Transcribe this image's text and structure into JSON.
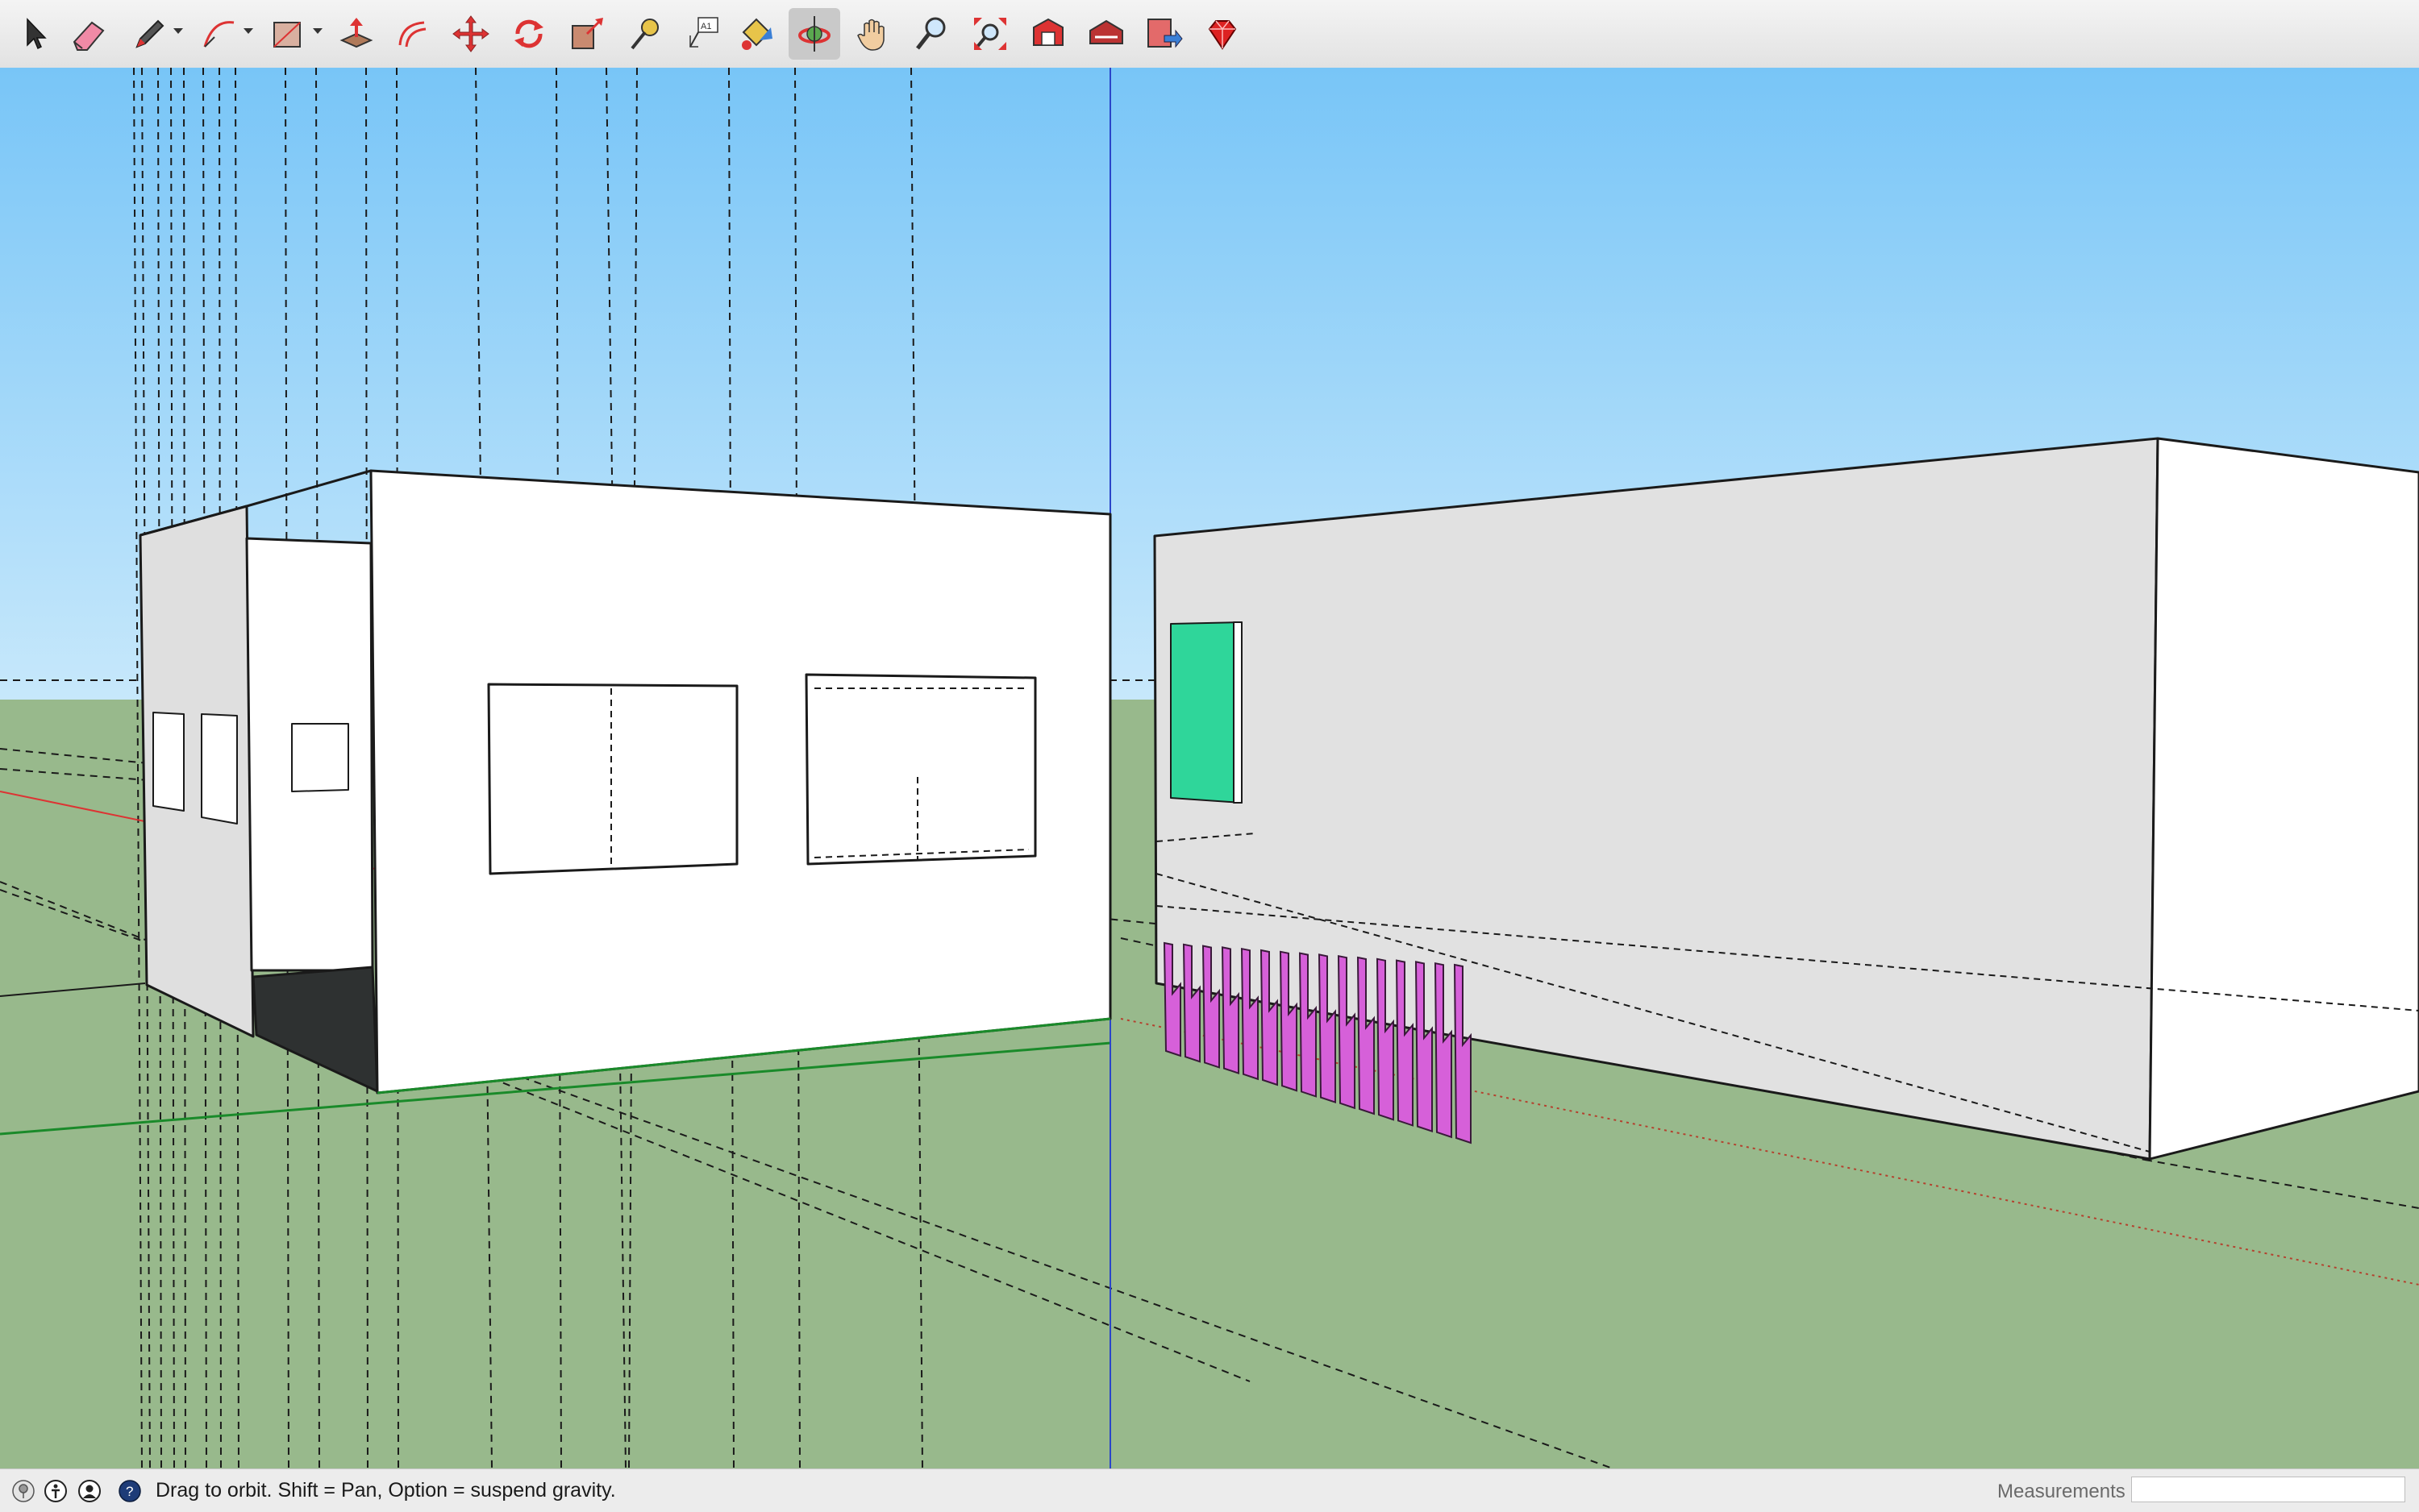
{
  "toolbar": {
    "tools": [
      {
        "name": "select-tool",
        "icon": "arrow-cursor-icon"
      },
      {
        "name": "eraser-tool",
        "icon": "eraser-icon"
      },
      {
        "name": "line-tool",
        "icon": "pencil-icon",
        "has_dropdown": true
      },
      {
        "name": "arc-tool",
        "icon": "arc-icon",
        "has_dropdown": true
      },
      {
        "name": "shapes-tool",
        "icon": "rectangle-icon",
        "has_dropdown": true
      },
      {
        "name": "push-pull-tool",
        "icon": "push-pull-icon"
      },
      {
        "name": "offset-tool",
        "icon": "offset-icon"
      },
      {
        "name": "move-tool",
        "icon": "move-arrows-icon"
      },
      {
        "name": "rotate-tool",
        "icon": "rotate-icon"
      },
      {
        "name": "scale-tool",
        "icon": "scale-icon"
      },
      {
        "name": "tape-measure-tool",
        "icon": "tape-measure-icon"
      },
      {
        "name": "text-tool",
        "icon": "text-label-icon",
        "label": "A1"
      },
      {
        "name": "paint-bucket-tool",
        "icon": "paint-bucket-icon"
      },
      {
        "name": "orbit-tool",
        "icon": "orbit-icon",
        "active": true
      },
      {
        "name": "pan-tool",
        "icon": "hand-icon"
      },
      {
        "name": "zoom-tool",
        "icon": "magnifier-icon"
      },
      {
        "name": "zoom-extents-tool",
        "icon": "zoom-extents-icon"
      },
      {
        "name": "3d-warehouse-tool",
        "icon": "warehouse-icon"
      },
      {
        "name": "extension-warehouse-tool",
        "icon": "extension-warehouse-icon"
      },
      {
        "name": "send-to-layout-tool",
        "icon": "layout-send-icon"
      },
      {
        "name": "extension-manager-tool",
        "icon": "ruby-gem-icon"
      }
    ]
  },
  "statusbar": {
    "icons": [
      "geo-location-icon",
      "credits-icon",
      "account-icon",
      "help-icon"
    ],
    "message": "Drag to orbit. Shift = Pan, Option = suspend gravity.",
    "measurements_label": "Measurements",
    "measurements_value": ""
  },
  "colors": {
    "sky_top": "#78c5f7",
    "sky_horizon": "#c7e8fb",
    "ground": "#98b98c",
    "wall_light": "#ffffff",
    "wall_shaded": "#e0e0e0",
    "opening_dark": "#2e3131",
    "green_panel": "#2fd69a",
    "magenta_fence": "#d660d9",
    "active_tool_bg": "#c9c9c9"
  }
}
